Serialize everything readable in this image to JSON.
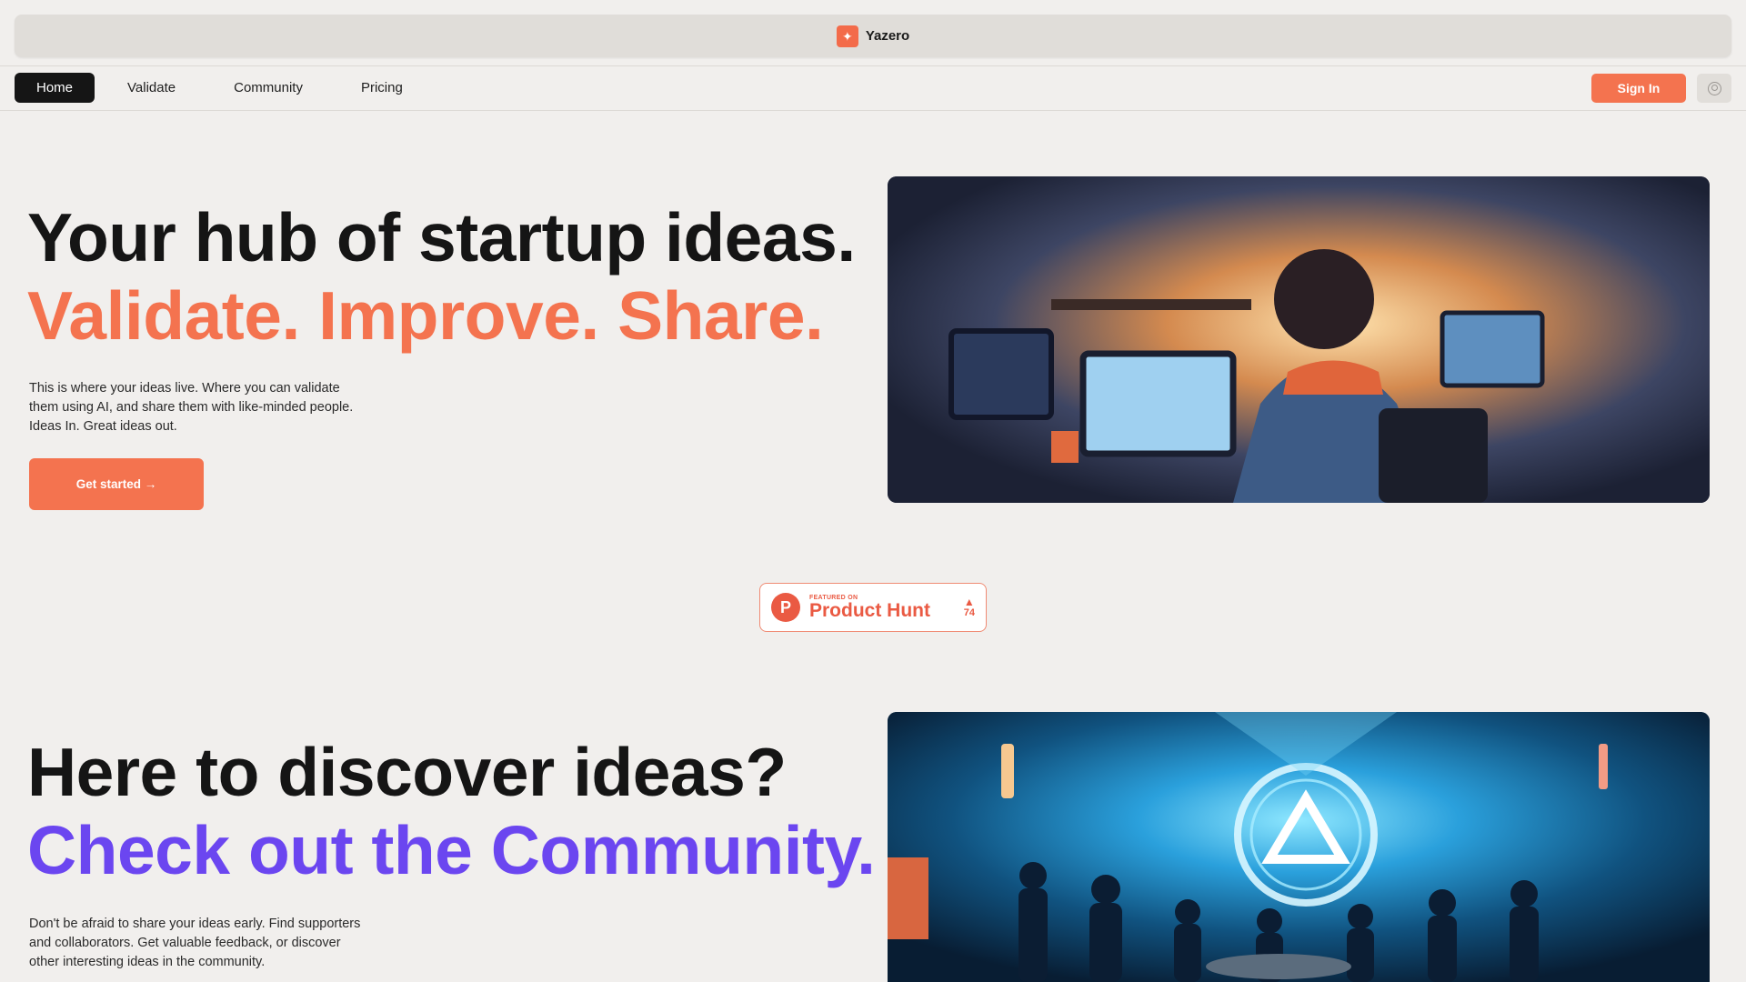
{
  "window": {
    "brand": "Yazero",
    "logo_icon": "sparkle-icon",
    "accent": "#f4734f"
  },
  "nav": {
    "items": [
      {
        "label": "Home",
        "active": true
      },
      {
        "label": "Validate",
        "active": false
      },
      {
        "label": "Community",
        "active": false
      },
      {
        "label": "Pricing",
        "active": false
      }
    ],
    "sign_in": "Sign In",
    "avatar_icon": "user-circle-icon"
  },
  "hero": {
    "title": "Your hub of startup ideas.",
    "subtitle": "Validate. Improve. Share.",
    "subtitle_color": "#f4734f",
    "description": "This is where your ideas live. Where you can validate them using AI, and share them with like-minded people. Ideas In. Great ideas out.",
    "cta": "Get started →",
    "image": "illustration of a person working at computers in a warm-lit room"
  },
  "product_hunt": {
    "featured": "FEATURED ON",
    "name": "Product Hunt",
    "logo_letter": "P",
    "arrow": "▲",
    "count": "74"
  },
  "community": {
    "title": "Here to discover ideas?",
    "subtitle": "Check out the Community.",
    "subtitle_color": "#6b46f0",
    "description": "Don't be afraid to share your ideas early. Find supporters and collaborators. Get valuable feedback, or discover other interesting ideas in the community.",
    "image": "illustration of a group of people gathered under a glowing blue triangle symbol"
  }
}
